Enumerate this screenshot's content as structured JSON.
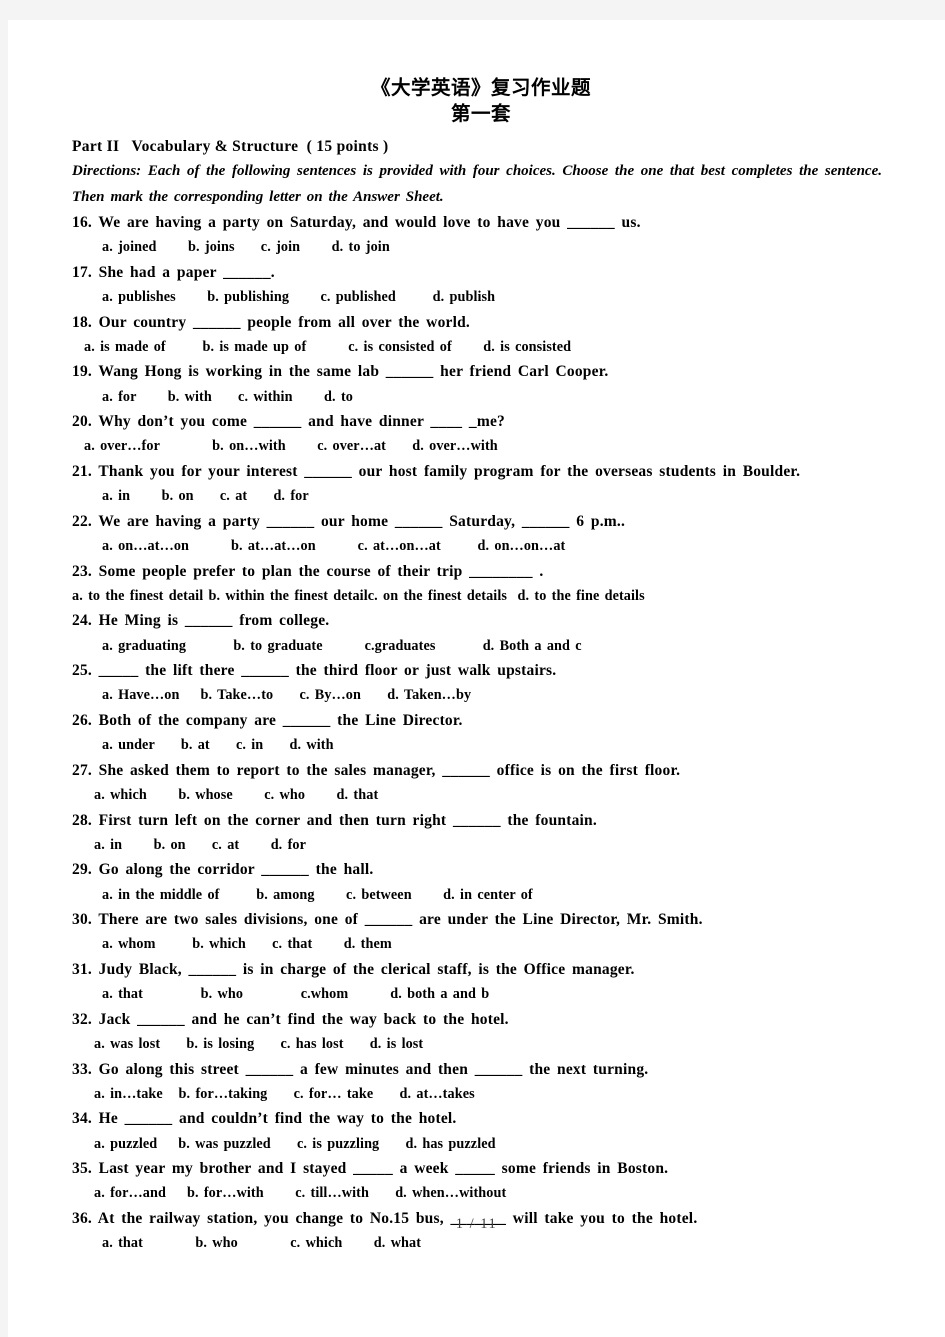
{
  "document": {
    "title": "《大学英语》复习作业题",
    "subtitle": "第一套",
    "part_heading": "Part II   Vocabulary & Structure  ( 15 points )",
    "directions": "Directions: Each of the following sentences is provided with four choices. Choose the one that best completes the sentence. Then mark the corresponding letter on the Answer Sheet.",
    "footer": "1 / 11"
  },
  "questions": [
    {
      "number": "16.",
      "stem": "16. We are having a party on Saturday, and would love to have you ______ us.",
      "options": "a. joined      b. joins     c. join      d. to join",
      "opt_indent": "ind-3"
    },
    {
      "number": "17.",
      "stem": "17. She had a paper ______.",
      "options": "a. publishes      b. publishing      c. published       d. publish",
      "opt_indent": "ind-3"
    },
    {
      "number": "18.",
      "stem": "18. Our country ______ people from all over the world.",
      "options": "a. is made of       b. is made up of        c. is consisted of      d. is consisted",
      "opt_indent": "ind-1"
    },
    {
      "number": "19.",
      "stem": "19. Wang Hong is working in the same lab ______ her friend Carl Cooper.",
      "options": "a. for      b. with     c. within      d. to",
      "opt_indent": "ind-3"
    },
    {
      "number": "20.",
      "stem": "20. Why don’t you come ______ and have dinner ____ _me?",
      "options": "a. over…for          b. on…with      c. over…at     d. over…with",
      "opt_indent": "ind-1"
    },
    {
      "number": "21.",
      "stem": "21. Thank you for your interest ______ our host family program for the overseas students in Boulder.",
      "options": "a. in      b. on     c. at     d. for",
      "opt_indent": "ind-3"
    },
    {
      "number": "22.",
      "stem": "22. We are having a party ______ our home ______ Saturday, ______ 6 p.m..",
      "options": "a. on…at…on        b. at…at…on        c. at…on…at       d. on…on…at",
      "opt_indent": "ind-3"
    },
    {
      "number": "23.",
      "stem": "23. Some people prefer to plan the course of their trip ________ .",
      "options": "a. to the finest detail b. within the finest detailc. on the finest details  d. to the fine details",
      "opt_indent": "ind-0"
    },
    {
      "number": "24.",
      "stem": "24. He Ming is ______ from college.",
      "options": "a. graduating         b. to graduate        c.graduates         d. Both a and c",
      "opt_indent": "ind-3"
    },
    {
      "number": "25.",
      "stem": "25. _____ the lift there ______ the third floor or just walk upstairs.",
      "options": "a. Have…on    b. Take…to     c. By…on     d. Taken…by",
      "opt_indent": "ind-3"
    },
    {
      "number": "26.",
      "stem": "26. Both of the company are ______ the Line Director.",
      "options": "a. under     b. at     c. in     d. with",
      "opt_indent": "ind-3"
    },
    {
      "number": "27.",
      "stem": "27. She asked them to report to the sales manager, ______ office is on the first floor.",
      "options": "a. which      b. whose      c. who      d. that",
      "opt_indent": "ind-2"
    },
    {
      "number": "28.",
      "stem": "28. First turn left on the corner and then turn right ______ the fountain.",
      "options": "a. in      b. on     c. at      d. for",
      "opt_indent": "ind-2"
    },
    {
      "number": "29.",
      "stem": "29. Go along the corridor ______ the hall.",
      "options": "a. in the middle of       b. among      c. between      d. in center of",
      "opt_indent": "ind-3"
    },
    {
      "number": "30.",
      "stem": "30. There are two sales divisions, one of ______ are under the Line Director, Mr. Smith.",
      "options": "a. whom       b. which     c. that      d. them",
      "opt_indent": "ind-3"
    },
    {
      "number": "31.",
      "stem": "31. Judy Black, ______ is in charge of the clerical staff, is the Office manager.",
      "options": "a. that           b. who           c.whom        d. both a and b",
      "opt_indent": "ind-3"
    },
    {
      "number": "32.",
      "stem": "32. Jack ______ and he can’t find the way back to the hotel.",
      "options": "a. was lost     b. is losing     c. has lost     d. is lost",
      "opt_indent": "ind-2"
    },
    {
      "number": "33.",
      "stem": "33. Go along this street ______ a few minutes and then ______ the next turning.",
      "options": "a. in…take   b. for…taking     c. for… take     d. at…takes",
      "opt_indent": "ind-2"
    },
    {
      "number": "34.",
      "stem": "34. He ______ and couldn’t find the way to the hotel.",
      "options": "a. puzzled    b. was puzzled     c. is puzzling     d. has puzzled",
      "opt_indent": "ind-2"
    },
    {
      "number": "35.",
      "stem": "35. Last year my brother and I stayed _____ a week _____ some friends in Boston.",
      "options": "a. for…and    b. for…with      c. till…with     d. when…without",
      "opt_indent": "ind-2"
    },
    {
      "number": "36.",
      "stem": "36. At the railway station, you change to No.15 bus, _______ will take you to the hotel.",
      "options": "a. that          b. who          c. which      d. what",
      "opt_indent": "ind-3"
    }
  ]
}
